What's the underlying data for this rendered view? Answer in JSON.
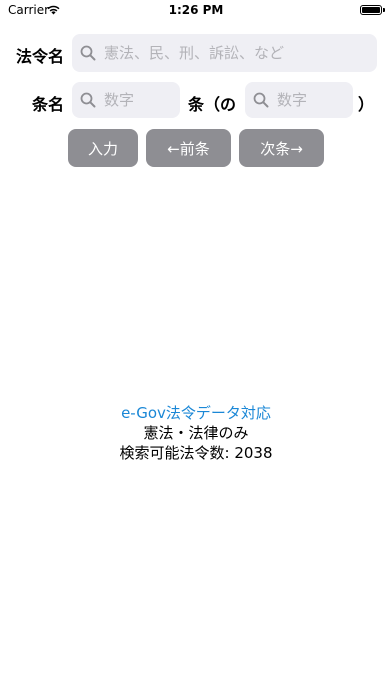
{
  "status_bar": {
    "carrier": "Carrier",
    "time": "1:26 PM"
  },
  "form": {
    "law_label": "法令名",
    "law_placeholder": "憲法、民、刑、訴訟、など",
    "article_label": "条名",
    "article_placeholder": "数字",
    "article_suffix": "条（の",
    "sub_placeholder": "数字",
    "close_paren": "）"
  },
  "buttons": {
    "enter": "入力",
    "prev": "←前条",
    "next": "次条→"
  },
  "info": {
    "link": "e-Gov法令データ対応",
    "scope": "憲法・法律のみ",
    "count": "検索可能法令数: 2038"
  },
  "colors": {
    "link": "#1a87d6",
    "button_bg": "#8e8e93",
    "field_bg": "#efeff4"
  }
}
